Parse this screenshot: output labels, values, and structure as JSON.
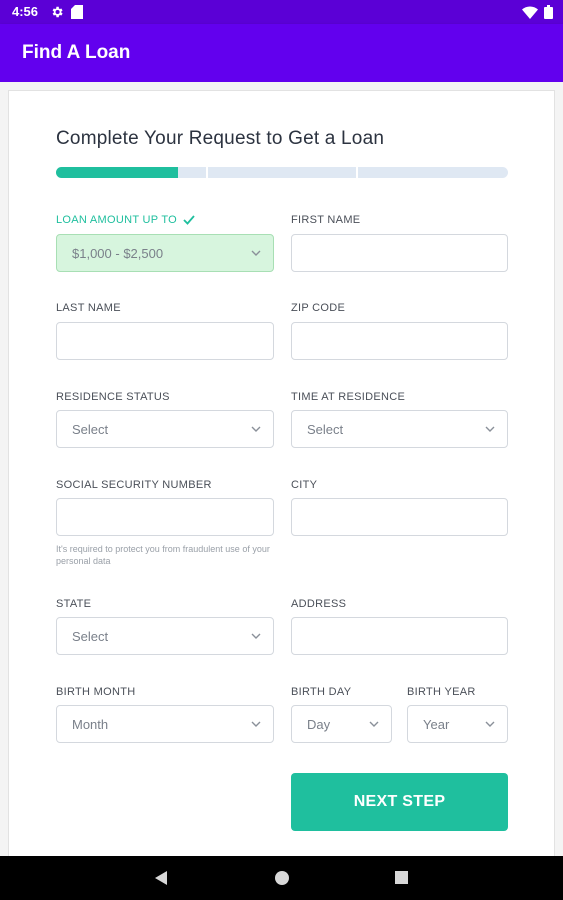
{
  "status_bar": {
    "time": "4:56",
    "icons": [
      "gear-icon",
      "sd-card-icon",
      "wifi-icon",
      "battery-icon"
    ]
  },
  "app_bar": {
    "title": "Find A Loan"
  },
  "form": {
    "title": "Complete Your Request to Get a Loan",
    "progress_fraction": 0.27,
    "progress_steps": 3,
    "fields": {
      "loan_amount": {
        "label": "LOAN AMOUNT UP TO",
        "value": "$1,000 - $2,500"
      },
      "first_name": {
        "label": "FIRST NAME",
        "value": ""
      },
      "last_name": {
        "label": "LAST NAME",
        "value": ""
      },
      "zip_code": {
        "label": "ZIP CODE",
        "value": ""
      },
      "residence_status": {
        "label": "RESIDENCE STATUS",
        "value": "Select"
      },
      "time_at_residence": {
        "label": "TIME AT RESIDENCE",
        "value": "Select"
      },
      "ssn": {
        "label": "SOCIAL SECURITY NUMBER",
        "value": "",
        "hint": "It's required to protect you from fraudulent use of your personal data"
      },
      "city": {
        "label": "CITY",
        "value": ""
      },
      "state": {
        "label": "STATE",
        "value": "Select"
      },
      "address": {
        "label": "ADDRESS",
        "value": ""
      },
      "birth_month": {
        "label": "BIRTH MONTH",
        "value": "Month"
      },
      "birth_day": {
        "label": "BIRTH DAY",
        "value": "Day"
      },
      "birth_year": {
        "label": "BIRTH YEAR",
        "value": "Year"
      }
    },
    "next_button": "NEXT STEP"
  },
  "colors": {
    "status_bar": "#5b00d6",
    "app_bar": "#6200ee",
    "accent": "#1fbf9e",
    "valid_field_bg": "#d7f5de",
    "progress_track": "#dfe8f3"
  }
}
